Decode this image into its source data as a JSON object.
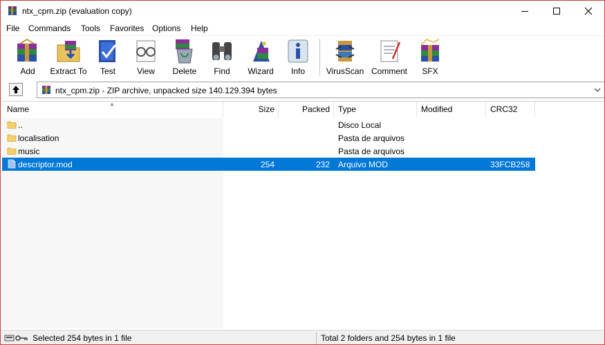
{
  "window": {
    "title": "ntx_cpm.zip (evaluation copy)"
  },
  "menu": {
    "items": [
      {
        "label": "File"
      },
      {
        "label": "Commands"
      },
      {
        "label": "Tools"
      },
      {
        "label": "Favorites"
      },
      {
        "label": "Options"
      },
      {
        "label": "Help"
      }
    ]
  },
  "toolbar": {
    "buttons": [
      {
        "label": "Add",
        "icon": "add-icon"
      },
      {
        "label": "Extract To",
        "icon": "extract-icon"
      },
      {
        "label": "Test",
        "icon": "test-icon"
      },
      {
        "label": "View",
        "icon": "view-icon"
      },
      {
        "label": "Delete",
        "icon": "delete-icon"
      },
      {
        "label": "Find",
        "icon": "binoculars-icon"
      },
      {
        "label": "Wizard",
        "icon": "wizard-icon"
      },
      {
        "label": "Info",
        "icon": "info-icon"
      },
      {
        "label": "VirusScan",
        "icon": "virusscan-icon"
      },
      {
        "label": "Comment",
        "icon": "comment-icon"
      },
      {
        "label": "SFX",
        "icon": "sfx-icon"
      }
    ]
  },
  "address": {
    "text": "ntx_cpm.zip - ZIP archive, unpacked size 140.129.394 bytes"
  },
  "columns": {
    "name": "Name",
    "size": "Size",
    "packed": "Packed",
    "type": "Type",
    "modified": "Modified",
    "crc": "CRC32"
  },
  "files": [
    {
      "name": "..",
      "size": "",
      "packed": "",
      "type": "Disco Local",
      "modified": "",
      "crc": "",
      "icon": "folder-icon",
      "selected": false
    },
    {
      "name": "localisation",
      "size": "",
      "packed": "",
      "type": "Pasta de arquivos",
      "modified": "",
      "crc": "",
      "icon": "folder-icon",
      "selected": false
    },
    {
      "name": "music",
      "size": "",
      "packed": "",
      "type": "Pasta de arquivos",
      "modified": "",
      "crc": "",
      "icon": "folder-icon",
      "selected": false
    },
    {
      "name": "descriptor.mod",
      "size": "254",
      "packed": "232",
      "type": "Arquivo MOD",
      "modified": "",
      "crc": "33FCB258",
      "icon": "file-icon",
      "selected": true
    }
  ],
  "status": {
    "left": "Selected 254 bytes in 1 file",
    "right": "Total 2 folders and 254 bytes in 1 file"
  },
  "colors": {
    "selection": "#0078d7",
    "window_border": "#c94040",
    "folder": "#f5d06a"
  }
}
